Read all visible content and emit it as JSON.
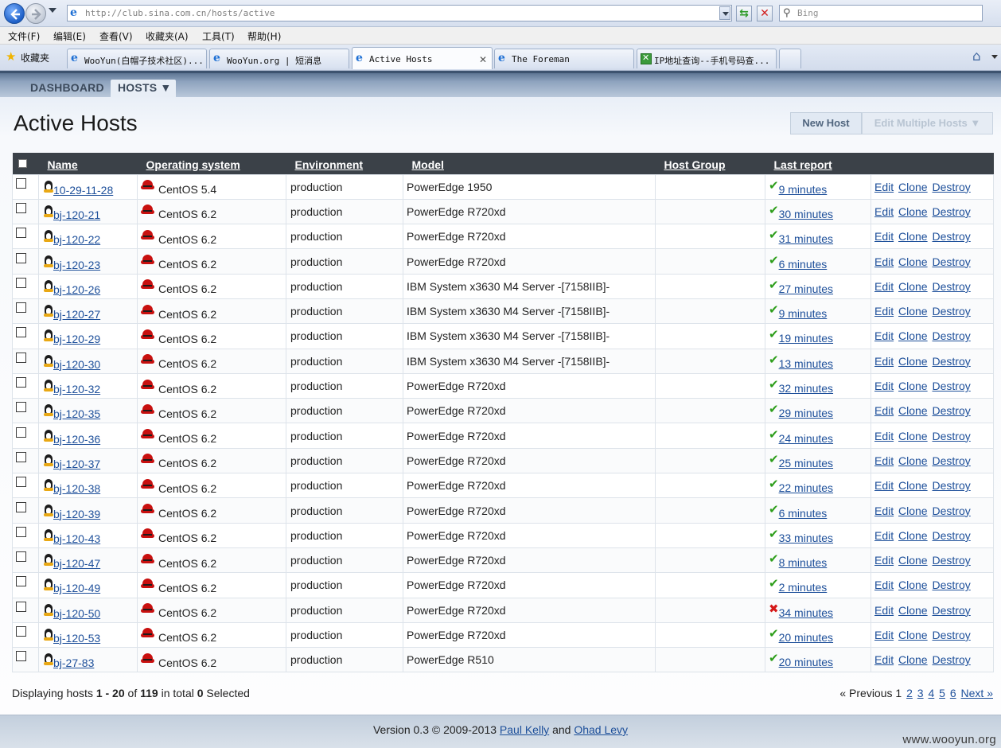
{
  "browser": {
    "url": "http://club.sina.com.cn/hosts/active",
    "search_placeholder": "Bing",
    "menu": [
      "文件(F)",
      "编辑(E)",
      "查看(V)",
      "收藏夹(A)",
      "工具(T)",
      "帮助(H)"
    ],
    "favorites_label": "收藏夹",
    "tabs": [
      {
        "title": "WooYun(白帽子技术社区)..."
      },
      {
        "title": "WooYun.org | 短消息"
      },
      {
        "title": "Active Hosts"
      },
      {
        "title": "The Foreman"
      },
      {
        "title": "IP地址查询--手机号码查..."
      }
    ]
  },
  "nav": {
    "dashboard": "DASHBOARD",
    "hosts": "HOSTS ▼"
  },
  "page": {
    "title": "Active Hosts",
    "new_host": "New Host",
    "edit_multiple": "Edit Multiple Hosts ▼"
  },
  "table": {
    "columns": [
      "Name",
      "Operating system",
      "Environment",
      "Model",
      "Host Group",
      "Last report"
    ],
    "rows": [
      {
        "name": "10-29-11-28",
        "os": "CentOS 5.4",
        "env": "production",
        "model": "PowerEdge 1950",
        "group": "",
        "report": "9 minutes",
        "ok": true
      },
      {
        "name": "bj-120-21",
        "os": "CentOS 6.2",
        "env": "production",
        "model": "PowerEdge R720xd",
        "group": "",
        "report": "30 minutes",
        "ok": true
      },
      {
        "name": "bj-120-22",
        "os": "CentOS 6.2",
        "env": "production",
        "model": "PowerEdge R720xd",
        "group": "",
        "report": "31 minutes",
        "ok": true
      },
      {
        "name": "bj-120-23",
        "os": "CentOS 6.2",
        "env": "production",
        "model": "PowerEdge R720xd",
        "group": "",
        "report": "6 minutes",
        "ok": true
      },
      {
        "name": "bj-120-26",
        "os": "CentOS 6.2",
        "env": "production",
        "model": "IBM System x3630 M4 Server -[7158IIB]-",
        "group": "",
        "report": "27 minutes",
        "ok": true
      },
      {
        "name": "bj-120-27",
        "os": "CentOS 6.2",
        "env": "production",
        "model": "IBM System x3630 M4 Server -[7158IIB]-",
        "group": "",
        "report": "9 minutes",
        "ok": true
      },
      {
        "name": "bj-120-29",
        "os": "CentOS 6.2",
        "env": "production",
        "model": "IBM System x3630 M4 Server -[7158IIB]-",
        "group": "",
        "report": "19 minutes",
        "ok": true
      },
      {
        "name": "bj-120-30",
        "os": "CentOS 6.2",
        "env": "production",
        "model": "IBM System x3630 M4 Server -[7158IIB]-",
        "group": "",
        "report": "13 minutes",
        "ok": true
      },
      {
        "name": "bj-120-32",
        "os": "CentOS 6.2",
        "env": "production",
        "model": "PowerEdge R720xd",
        "group": "",
        "report": "32 minutes",
        "ok": true
      },
      {
        "name": "bj-120-35",
        "os": "CentOS 6.2",
        "env": "production",
        "model": "PowerEdge R720xd",
        "group": "",
        "report": "29 minutes",
        "ok": true
      },
      {
        "name": "bj-120-36",
        "os": "CentOS 6.2",
        "env": "production",
        "model": "PowerEdge R720xd",
        "group": "",
        "report": "24 minutes",
        "ok": true
      },
      {
        "name": "bj-120-37",
        "os": "CentOS 6.2",
        "env": "production",
        "model": "PowerEdge R720xd",
        "group": "",
        "report": "25 minutes",
        "ok": true
      },
      {
        "name": "bj-120-38",
        "os": "CentOS 6.2",
        "env": "production",
        "model": "PowerEdge R720xd",
        "group": "",
        "report": "22 minutes",
        "ok": true
      },
      {
        "name": "bj-120-39",
        "os": "CentOS 6.2",
        "env": "production",
        "model": "PowerEdge R720xd",
        "group": "",
        "report": "6 minutes",
        "ok": true
      },
      {
        "name": "bj-120-43",
        "os": "CentOS 6.2",
        "env": "production",
        "model": "PowerEdge R720xd",
        "group": "",
        "report": "33 minutes",
        "ok": true
      },
      {
        "name": "bj-120-47",
        "os": "CentOS 6.2",
        "env": "production",
        "model": "PowerEdge R720xd",
        "group": "",
        "report": "8 minutes",
        "ok": true
      },
      {
        "name": "bj-120-49",
        "os": "CentOS 6.2",
        "env": "production",
        "model": "PowerEdge R720xd",
        "group": "",
        "report": "2 minutes",
        "ok": true
      },
      {
        "name": "bj-120-50",
        "os": "CentOS 6.2",
        "env": "production",
        "model": "PowerEdge R720xd",
        "group": "",
        "report": "34 minutes",
        "ok": false
      },
      {
        "name": "bj-120-53",
        "os": "CentOS 6.2",
        "env": "production",
        "model": "PowerEdge R720xd",
        "group": "",
        "report": "20 minutes",
        "ok": true
      },
      {
        "name": "bj-27-83",
        "os": "CentOS 6.2",
        "env": "production",
        "model": "PowerEdge R510",
        "group": "",
        "report": "20 minutes",
        "ok": true
      }
    ],
    "actions": [
      "Edit",
      "Clone",
      "Destroy"
    ]
  },
  "summary": {
    "prefix": "Displaying hosts",
    "range": "1 - 20",
    "of_label": "of",
    "total": "119",
    "in_total_label": "in total",
    "selected": "0",
    "selected_label": "Selected"
  },
  "pagination": {
    "previous": "« Previous",
    "current": "1",
    "pages": [
      "2",
      "3",
      "4",
      "5",
      "6"
    ],
    "next": "Next »"
  },
  "footer": {
    "version": "Version 0.3 © 2009-2013",
    "author1": "Paul Kelly",
    "and_label": "and",
    "author2": "Ohad Levy"
  },
  "watermark": "www.wooyun.org",
  "colors": {
    "ok": "#2e9e1b",
    "error": "#d51818",
    "link": "#1d4f9a",
    "header_bg": "#3b4148"
  }
}
